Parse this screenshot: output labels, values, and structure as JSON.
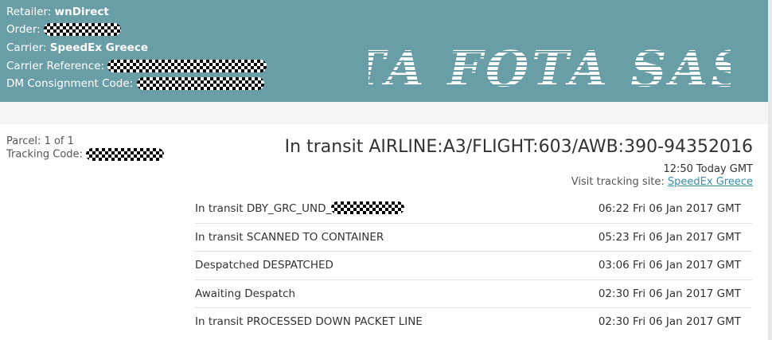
{
  "header": {
    "retailer_label": "Retailer:",
    "retailer_value": "wnDirect",
    "order_label": "Order:",
    "carrier_label": "Carrier:",
    "carrier_value": "SpeedEx Greece",
    "carrier_ref_label": "Carrier Reference:",
    "dm_code_label": "DM Consignment Code:",
    "logo_text": "TA FOTA SAS"
  },
  "parcel": {
    "parcel_label": "Parcel:",
    "parcel_value": "1 of 1",
    "tracking_label": "Tracking Code:"
  },
  "status": {
    "main": "In transit AIRLINE:A3/FLIGHT:603/AWB:390-94352016",
    "time": "12:50 Today GMT",
    "visit_label": "Visit tracking site:",
    "visit_link": "SpeedEx Greece"
  },
  "events": [
    {
      "desc": "In transit DBY_GRC_UND_",
      "time": "06:22 Fri 06 Jan 2017 GMT",
      "redacted": true
    },
    {
      "desc": "In transit SCANNED TO CONTAINER",
      "time": "05:23 Fri 06 Jan 2017 GMT"
    },
    {
      "desc": "Despatched DESPATCHED",
      "time": "03:06 Fri 06 Jan 2017 GMT"
    },
    {
      "desc": "Awaiting Despatch",
      "time": "02:30 Fri 06 Jan 2017 GMT"
    },
    {
      "desc": "In transit PROCESSED DOWN PACKET LINE",
      "time": "02:30 Fri 06 Jan 2017 GMT"
    }
  ],
  "colors": {
    "header_bg": "#6a9ea6",
    "link": "#3a8fa8"
  }
}
